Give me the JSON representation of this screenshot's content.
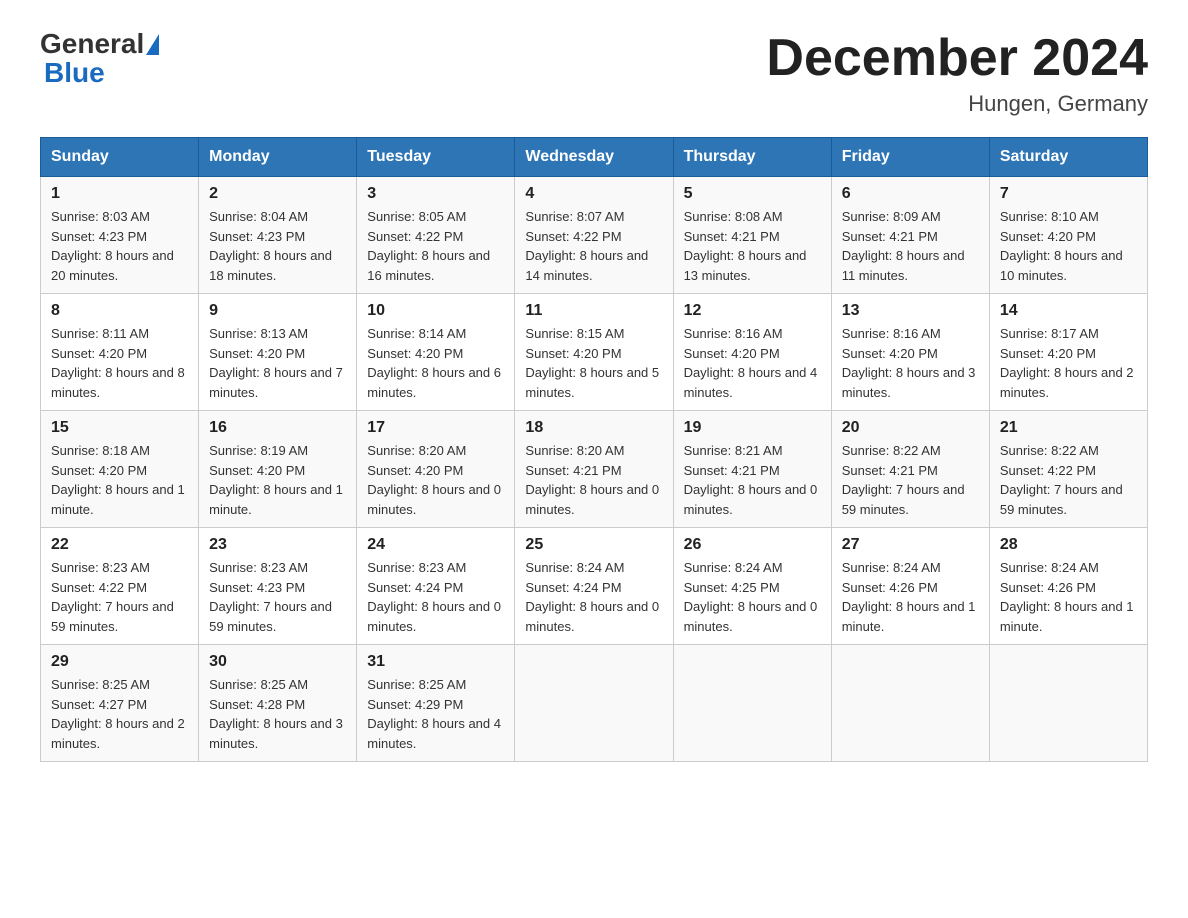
{
  "header": {
    "logo_general": "General",
    "logo_blue": "Blue",
    "month_year": "December 2024",
    "location": "Hungen, Germany"
  },
  "days_of_week": [
    "Sunday",
    "Monday",
    "Tuesday",
    "Wednesday",
    "Thursday",
    "Friday",
    "Saturday"
  ],
  "weeks": [
    [
      {
        "day": "1",
        "sunrise": "8:03 AM",
        "sunset": "4:23 PM",
        "daylight": "8 hours and 20 minutes."
      },
      {
        "day": "2",
        "sunrise": "8:04 AM",
        "sunset": "4:23 PM",
        "daylight": "8 hours and 18 minutes."
      },
      {
        "day": "3",
        "sunrise": "8:05 AM",
        "sunset": "4:22 PM",
        "daylight": "8 hours and 16 minutes."
      },
      {
        "day": "4",
        "sunrise": "8:07 AM",
        "sunset": "4:22 PM",
        "daylight": "8 hours and 14 minutes."
      },
      {
        "day": "5",
        "sunrise": "8:08 AM",
        "sunset": "4:21 PM",
        "daylight": "8 hours and 13 minutes."
      },
      {
        "day": "6",
        "sunrise": "8:09 AM",
        "sunset": "4:21 PM",
        "daylight": "8 hours and 11 minutes."
      },
      {
        "day": "7",
        "sunrise": "8:10 AM",
        "sunset": "4:20 PM",
        "daylight": "8 hours and 10 minutes."
      }
    ],
    [
      {
        "day": "8",
        "sunrise": "8:11 AM",
        "sunset": "4:20 PM",
        "daylight": "8 hours and 8 minutes."
      },
      {
        "day": "9",
        "sunrise": "8:13 AM",
        "sunset": "4:20 PM",
        "daylight": "8 hours and 7 minutes."
      },
      {
        "day": "10",
        "sunrise": "8:14 AM",
        "sunset": "4:20 PM",
        "daylight": "8 hours and 6 minutes."
      },
      {
        "day": "11",
        "sunrise": "8:15 AM",
        "sunset": "4:20 PM",
        "daylight": "8 hours and 5 minutes."
      },
      {
        "day": "12",
        "sunrise": "8:16 AM",
        "sunset": "4:20 PM",
        "daylight": "8 hours and 4 minutes."
      },
      {
        "day": "13",
        "sunrise": "8:16 AM",
        "sunset": "4:20 PM",
        "daylight": "8 hours and 3 minutes."
      },
      {
        "day": "14",
        "sunrise": "8:17 AM",
        "sunset": "4:20 PM",
        "daylight": "8 hours and 2 minutes."
      }
    ],
    [
      {
        "day": "15",
        "sunrise": "8:18 AM",
        "sunset": "4:20 PM",
        "daylight": "8 hours and 1 minute."
      },
      {
        "day": "16",
        "sunrise": "8:19 AM",
        "sunset": "4:20 PM",
        "daylight": "8 hours and 1 minute."
      },
      {
        "day": "17",
        "sunrise": "8:20 AM",
        "sunset": "4:20 PM",
        "daylight": "8 hours and 0 minutes."
      },
      {
        "day": "18",
        "sunrise": "8:20 AM",
        "sunset": "4:21 PM",
        "daylight": "8 hours and 0 minutes."
      },
      {
        "day": "19",
        "sunrise": "8:21 AM",
        "sunset": "4:21 PM",
        "daylight": "8 hours and 0 minutes."
      },
      {
        "day": "20",
        "sunrise": "8:22 AM",
        "sunset": "4:21 PM",
        "daylight": "7 hours and 59 minutes."
      },
      {
        "day": "21",
        "sunrise": "8:22 AM",
        "sunset": "4:22 PM",
        "daylight": "7 hours and 59 minutes."
      }
    ],
    [
      {
        "day": "22",
        "sunrise": "8:23 AM",
        "sunset": "4:22 PM",
        "daylight": "7 hours and 59 minutes."
      },
      {
        "day": "23",
        "sunrise": "8:23 AM",
        "sunset": "4:23 PM",
        "daylight": "7 hours and 59 minutes."
      },
      {
        "day": "24",
        "sunrise": "8:23 AM",
        "sunset": "4:24 PM",
        "daylight": "8 hours and 0 minutes."
      },
      {
        "day": "25",
        "sunrise": "8:24 AM",
        "sunset": "4:24 PM",
        "daylight": "8 hours and 0 minutes."
      },
      {
        "day": "26",
        "sunrise": "8:24 AM",
        "sunset": "4:25 PM",
        "daylight": "8 hours and 0 minutes."
      },
      {
        "day": "27",
        "sunrise": "8:24 AM",
        "sunset": "4:26 PM",
        "daylight": "8 hours and 1 minute."
      },
      {
        "day": "28",
        "sunrise": "8:24 AM",
        "sunset": "4:26 PM",
        "daylight": "8 hours and 1 minute."
      }
    ],
    [
      {
        "day": "29",
        "sunrise": "8:25 AM",
        "sunset": "4:27 PM",
        "daylight": "8 hours and 2 minutes."
      },
      {
        "day": "30",
        "sunrise": "8:25 AM",
        "sunset": "4:28 PM",
        "daylight": "8 hours and 3 minutes."
      },
      {
        "day": "31",
        "sunrise": "8:25 AM",
        "sunset": "4:29 PM",
        "daylight": "8 hours and 4 minutes."
      },
      null,
      null,
      null,
      null
    ]
  ]
}
